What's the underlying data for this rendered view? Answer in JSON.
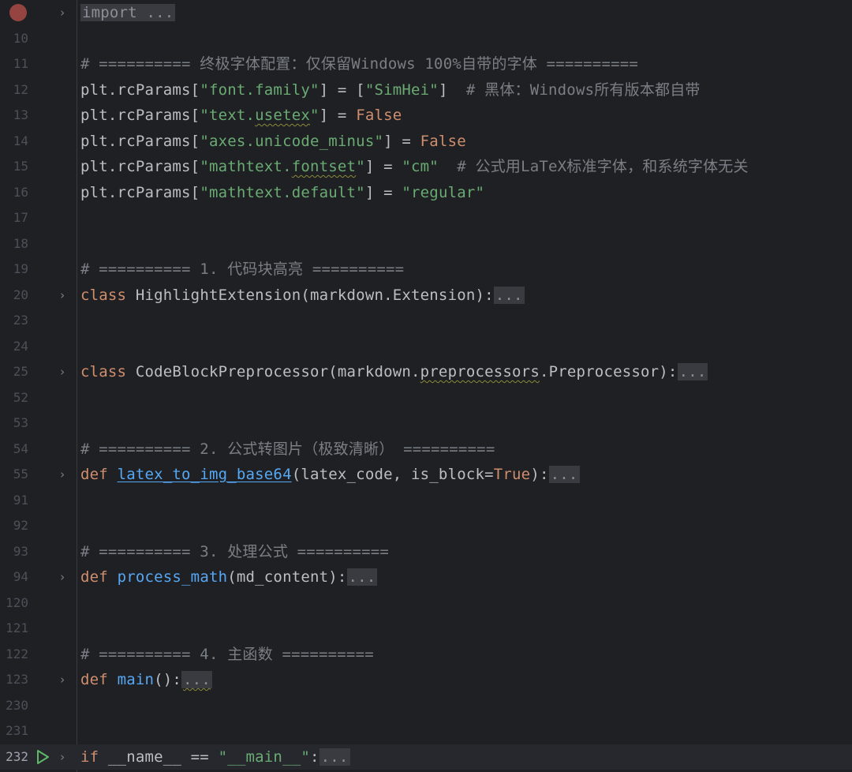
{
  "lines": [
    {
      "num": "",
      "code": "import ..."
    },
    {
      "num": "10",
      "code": ""
    },
    {
      "num": "11",
      "code": "# ========== 终极字体配置：仅保留Windows 100%自带的字体 =========="
    },
    {
      "num": "12",
      "code_a": "plt.rcParams[",
      "code_b": "\"font.family\"",
      "code_c": "] = [",
      "code_d": "\"SimHei\"",
      "code_e": "]",
      "comment": "  # 黑体：Windows所有版本都自带"
    },
    {
      "num": "13",
      "code_a": "plt.rcParams[",
      "code_b1": "\"text.",
      "code_b2": "usetex",
      "code_b3": "\"",
      "code_c": "] = ",
      "code_d": "False"
    },
    {
      "num": "14",
      "code_a": "plt.rcParams[",
      "code_b": "\"axes.unicode_minus\"",
      "code_c": "] = ",
      "code_d": "False"
    },
    {
      "num": "15",
      "code_a": "plt.rcParams[",
      "code_b1": "\"mathtext.",
      "code_b2": "fontset",
      "code_b3": "\"",
      "code_c": "] = ",
      "code_d": "\"cm\"",
      "comment": "  # 公式用LaTeX标准字体，和系统字体无关"
    },
    {
      "num": "16",
      "code_a": "plt.rcParams[",
      "code_b": "\"mathtext.default\"",
      "code_c": "] = ",
      "code_d": "\"regular\""
    },
    {
      "num": "17"
    },
    {
      "num": "18"
    },
    {
      "num": "19",
      "comment": "# ========== 1. 代码块高亮 =========="
    },
    {
      "num": "20",
      "kw": "class",
      "name": " HighlightExtension(markdown.Extension):",
      "fold": "..."
    },
    {
      "num": "23"
    },
    {
      "num": "24"
    },
    {
      "num": "25",
      "kw": "class",
      "name_a": " CodeBlockPreprocessor(markdown.",
      "name_b": "preprocessors",
      "name_c": ".Preprocessor):",
      "fold": "..."
    },
    {
      "num": "52"
    },
    {
      "num": "53"
    },
    {
      "num": "54",
      "comment": "# ========== 2. 公式转图片（极致清晰） =========="
    },
    {
      "num": "55",
      "kw": "def",
      "fn": "latex_to_img_base64",
      "args_a": "(latex_code, is_block=",
      "args_b": "True",
      "args_c": "):",
      "fold": "..."
    },
    {
      "num": "91"
    },
    {
      "num": "92"
    },
    {
      "num": "93",
      "comment": "# ========== 3. 处理公式 =========="
    },
    {
      "num": "94",
      "kw": "def",
      "fn": "process_math",
      "args": "(md_content):",
      "fold": "..."
    },
    {
      "num": "120"
    },
    {
      "num": "121"
    },
    {
      "num": "122",
      "comment": "# ========== 4. 主函数 =========="
    },
    {
      "num": "123",
      "kw": "def",
      "fn": "main",
      "args": "():",
      "fold": "..."
    },
    {
      "num": "230"
    },
    {
      "num": "231"
    },
    {
      "num": "232",
      "kw": "if",
      "name": " __name__ == ",
      "str": "\"__main__\"",
      "colon": ":",
      "fold": "..."
    }
  ],
  "icons": {
    "fold_chevron": "›",
    "breakpoint_color": "#c75450",
    "run_color": "#5fb865"
  }
}
